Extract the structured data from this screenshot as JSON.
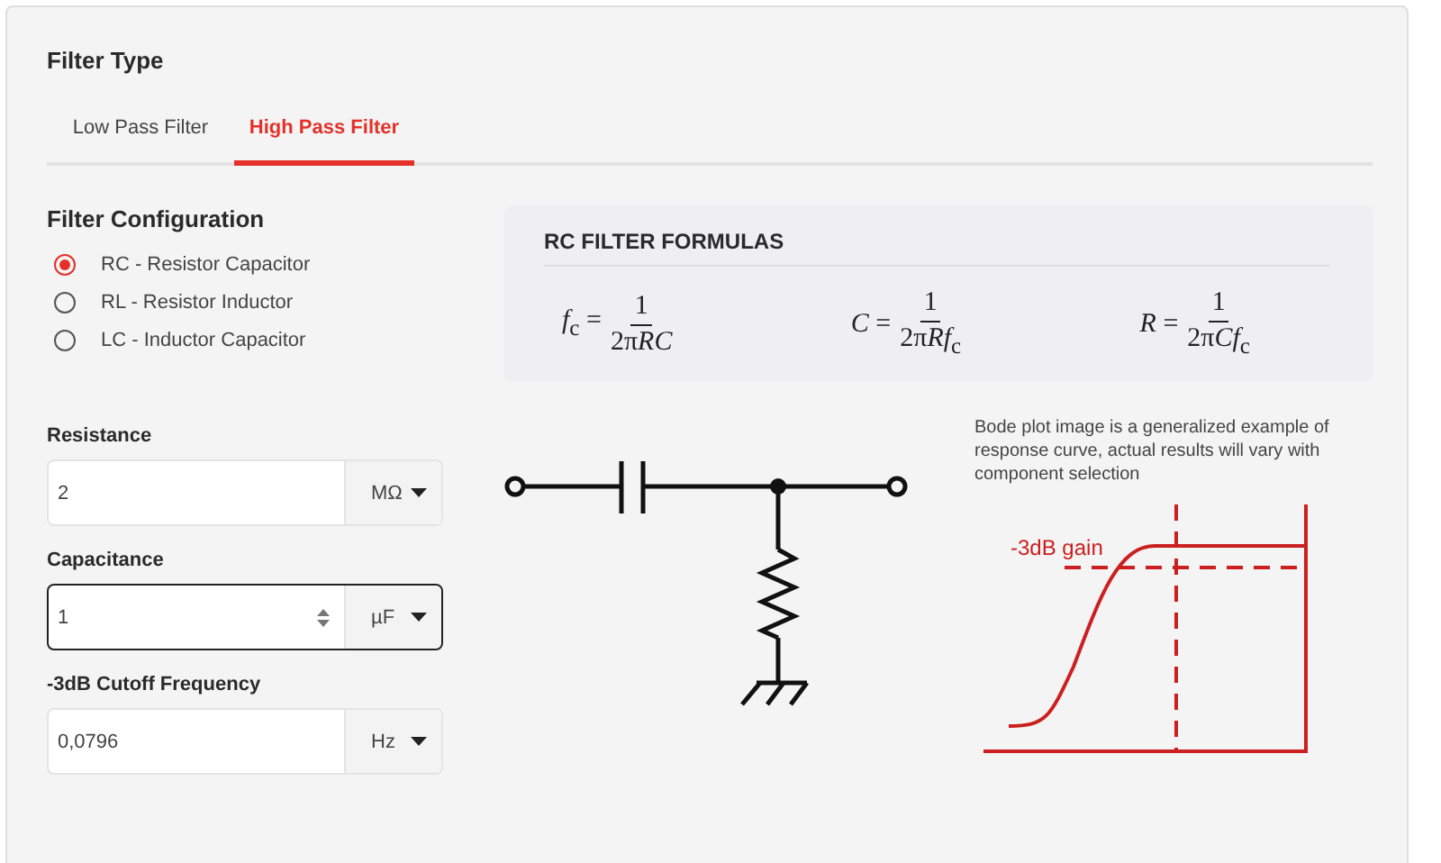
{
  "filter_type": {
    "title": "Filter Type",
    "tabs": [
      {
        "label": "Low Pass Filter",
        "selected": false
      },
      {
        "label": "High Pass Filter",
        "selected": true
      }
    ]
  },
  "configuration": {
    "title": "Filter Configuration",
    "options": [
      {
        "label": "RC - Resistor Capacitor",
        "selected": true
      },
      {
        "label": "RL - Resistor Inductor",
        "selected": false
      },
      {
        "label": "LC - Inductor Capacitor",
        "selected": false
      }
    ]
  },
  "formulas": {
    "title": "RC FILTER FORMULAS",
    "items": [
      {
        "lhs": "*f*$_{c}$ =",
        "numerator": "1",
        "coefficient": "2π",
        "variables": "RC"
      },
      {
        "lhs": "*C* =",
        "numerator": "1",
        "coefficient": "2π",
        "variables": "Rf",
        "subscript": "c"
      },
      {
        "lhs": "*R* =",
        "numerator": "1",
        "coefficient": "2π",
        "variables": "Cf",
        "subscript": "c"
      }
    ]
  },
  "fields": [
    {
      "label": "Resistance",
      "value": "2",
      "unit": "MΩ",
      "focused": false
    },
    {
      "label": "Capacitance",
      "value": "1",
      "unit": "µF",
      "focused": true
    },
    {
      "label": "-3dB Cutoff Frequency",
      "value": "0,0796",
      "unit": "Hz",
      "focused": false
    }
  ],
  "bode": {
    "note": "Bode plot image is a generalized example of response curve, actual results will vary with component selection",
    "gain_label": "-3dB gain"
  }
}
